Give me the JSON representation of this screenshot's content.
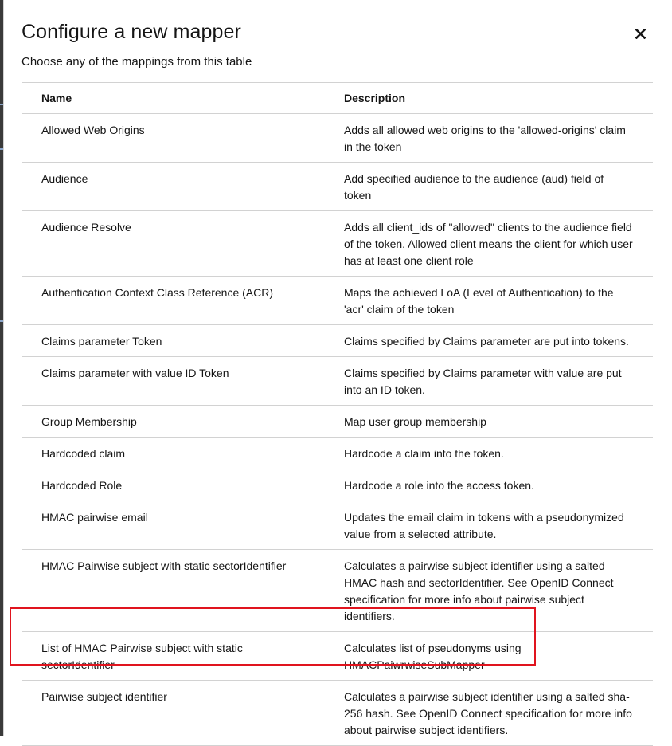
{
  "modal": {
    "title": "Configure a new mapper",
    "subtitle": "Choose any of the mappings from this table",
    "close_icon": "close-icon"
  },
  "table": {
    "columns": [
      "Name",
      "Description"
    ],
    "rows": [
      {
        "name": "Allowed Web Origins",
        "description": "Adds all allowed web origins to the 'allowed-origins' claim in the token"
      },
      {
        "name": "Audience",
        "description": "Add specified audience to the audience (aud) field of token"
      },
      {
        "name": "Audience Resolve",
        "description": "Adds all client_ids of \"allowed\" clients to the audience field of the token. Allowed client means the client for which user has at least one client role"
      },
      {
        "name": "Authentication Context Class Reference (ACR)",
        "description": "Maps the achieved LoA (Level of Authentication) to the 'acr' claim of the token"
      },
      {
        "name": "Claims parameter Token",
        "description": "Claims specified by Claims parameter are put into tokens."
      },
      {
        "name": "Claims parameter with value ID Token",
        "description": "Claims specified by Claims parameter with value are put into an ID token."
      },
      {
        "name": "Group Membership",
        "description": "Map user group membership"
      },
      {
        "name": "Hardcoded claim",
        "description": "Hardcode a claim into the token."
      },
      {
        "name": "Hardcoded Role",
        "description": "Hardcode a role into the access token."
      },
      {
        "name": "HMAC pairwise email",
        "description": "Updates the email claim in tokens with a pseudonymized value from a selected attribute."
      },
      {
        "name": "HMAC Pairwise subject with static sectorIdentifier",
        "description": "Calculates a pairwise subject identifier using a salted HMAC hash and sectorIdentifier. See OpenID Connect specification for more info about pairwise subject identifiers."
      },
      {
        "name": "List of HMAC Pairwise subject with static sectorIdentifier",
        "description": "Calculates list of pseudonyms using HMACPaiwrwiseSubMapper"
      },
      {
        "name": "Pairwise subject identifier",
        "description": "Calculates a pairwise subject identifier using a salted sha-256 hash. See OpenID Connect specification for more info about pairwise subject identifiers."
      }
    ]
  },
  "highlight": {
    "row_index": 11,
    "color": "#e0141e"
  }
}
